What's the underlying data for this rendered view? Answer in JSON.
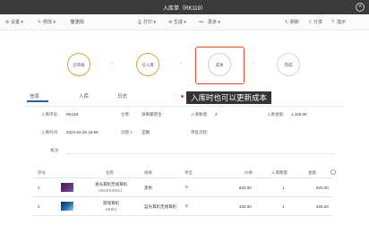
{
  "window": {
    "title": "入库单（RK119）"
  },
  "toolbar": {
    "left": [
      {
        "icon": "settings-icon",
        "glyph": "⚙",
        "label": "设置 ▾"
      },
      {
        "icon": "edit-icon",
        "glyph": "✎",
        "label": "修改 ▾"
      },
      {
        "icon": "delete-icon",
        "glyph": "🗑",
        "label": "删除"
      }
    ],
    "center": [
      {
        "icon": "print-icon",
        "glyph": "⎙",
        "label": "打印 ▾"
      },
      {
        "icon": "generate-icon",
        "glyph": "⊕",
        "label": "生成 ▾"
      },
      {
        "icon": "more-icon",
        "glyph": "•••",
        "label": "更多 ▾"
      }
    ],
    "right": [
      {
        "icon": "refresh-icon",
        "glyph": "↻",
        "label": "刷新"
      },
      {
        "icon": "share-icon",
        "glyph": "⇪",
        "label": "分享"
      },
      {
        "icon": "help-icon",
        "glyph": "?",
        "label": "指示"
      }
    ]
  },
  "steps": [
    "已审核",
    "已入库",
    "成本",
    "完成"
  ],
  "tabs": [
    "信息",
    "入库",
    "日志"
  ],
  "tooltip": "入库时也可以更新成本",
  "form": {
    "labels": {
      "number": "入库单号:",
      "warehouse": "仓库:",
      "qty": "入库数量:",
      "amount": "入库金额:",
      "time": "入库时间:",
      "creator": "创建人:",
      "approver": "审批流程:",
      "remark": "备注:"
    },
    "values": {
      "number": "RK119",
      "warehouse": "深圳发货仓",
      "qty": "2",
      "amount": "1,246.00",
      "time": "2024-02-26 16:59",
      "creator": "王刚"
    }
  },
  "table": {
    "headers": [
      "序号",
      "名称",
      "规格",
      "单位",
      "价格",
      "入库数量",
      "金额"
    ],
    "rows": [
      {
        "index": "1",
        "name": "发光耳机无线耳机",
        "code": "HEMHN001J",
        "spec": "黑色",
        "unit": "个",
        "price": "820.00",
        "qty": "1",
        "amount": "820.00"
      },
      {
        "index": "2",
        "name": "游戏耳机",
        "code": "MHEJ",
        "spec": "蓝光耳机无线耳机",
        "unit": "个",
        "price": "426.00",
        "qty": "1",
        "amount": "426.00"
      }
    ]
  },
  "colors": {
    "accent": "#2e5f9a",
    "highlight": "#e04b2c",
    "step_done": "#d9a441"
  }
}
